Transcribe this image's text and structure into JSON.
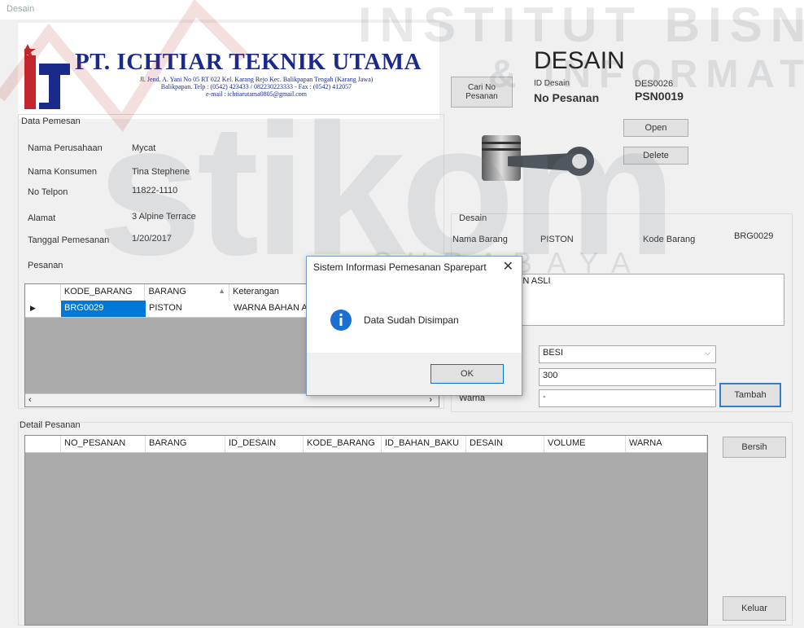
{
  "window": {
    "title": "Desain"
  },
  "header": {
    "company": "PT. ICHTIAR TEKNIK UTAMA",
    "address_line1": "Jl. Jend. A. Yani No 05 RT 022 Kel. Karang Rejo Kec. Balikpapan Tengah (Karang Jawa)",
    "address_line2": "Balikpapan. Telp : (0542) 423433 / 082230223333 - Fax : (0542) 412057",
    "address_line3": "e-mail : ichtiarutama0805@gmail.com"
  },
  "form_title": "DESAIN",
  "top": {
    "cari_button": "Cari No Pesanan",
    "id_desain_label": "ID Desain",
    "id_desain_value": "DES0026",
    "no_pesanan_label": "No Pesanan",
    "no_pesanan_value": "PSN0019"
  },
  "data_pemesanan": {
    "title": "Data Pemesan",
    "fields": [
      {
        "label": "Nama Perusahaan",
        "value": "Mycat"
      },
      {
        "label": "Nama Konsumen",
        "value": "Tina Stephene"
      },
      {
        "label": "No Telpon",
        "value": "11822-1110"
      },
      {
        "label": "Alamat",
        "value": "3 Alpine Terrace"
      },
      {
        "label": "Tanggal Pemesanan",
        "value": "1/20/2017"
      }
    ],
    "pesanan_label": "Pesanan"
  },
  "pesanan_grid": {
    "columns": [
      "KODE_BARANG",
      "BARANG",
      "Keterangan"
    ],
    "rows": [
      {
        "kode": "BRG0029",
        "barang": "PISTON",
        "keterangan": "WARNA BAHAN A"
      }
    ]
  },
  "image_buttons": {
    "open": "Open",
    "delete": "Delete"
  },
  "desain": {
    "title": "Desain",
    "nama_barang_label": "Nama Barang",
    "nama_barang_value": "PISTON",
    "kode_barang_label": "Kode Barang",
    "kode_barang_value": "BRG0029",
    "keterangan_value": "AN ASLI",
    "bahan_value": "BESI",
    "volume_value": "300",
    "warna_label": "Warna",
    "warna_value": "-",
    "tambah_button": "Tambah"
  },
  "detail": {
    "title": "Detail Pesanan",
    "columns": [
      "NO_PESANAN",
      "BARANG",
      "ID_DESAIN",
      "KODE_BARANG",
      "ID_BAHAN_BAKU",
      "DESAIN",
      "VOLUME",
      "WARNA"
    ],
    "bersih_button": "Bersih",
    "keluar_button": "Keluar"
  },
  "dialog": {
    "title": "Sistem Informasi Pemesanan Sparepart",
    "message": "Data Sudah Disimpan",
    "ok_button": "OK"
  },
  "watermark": {
    "line1": "INSTITUT BISNIS",
    "line2": "& INFORMATIKA",
    "brand": "stikom",
    "city": "SURABAYA"
  }
}
